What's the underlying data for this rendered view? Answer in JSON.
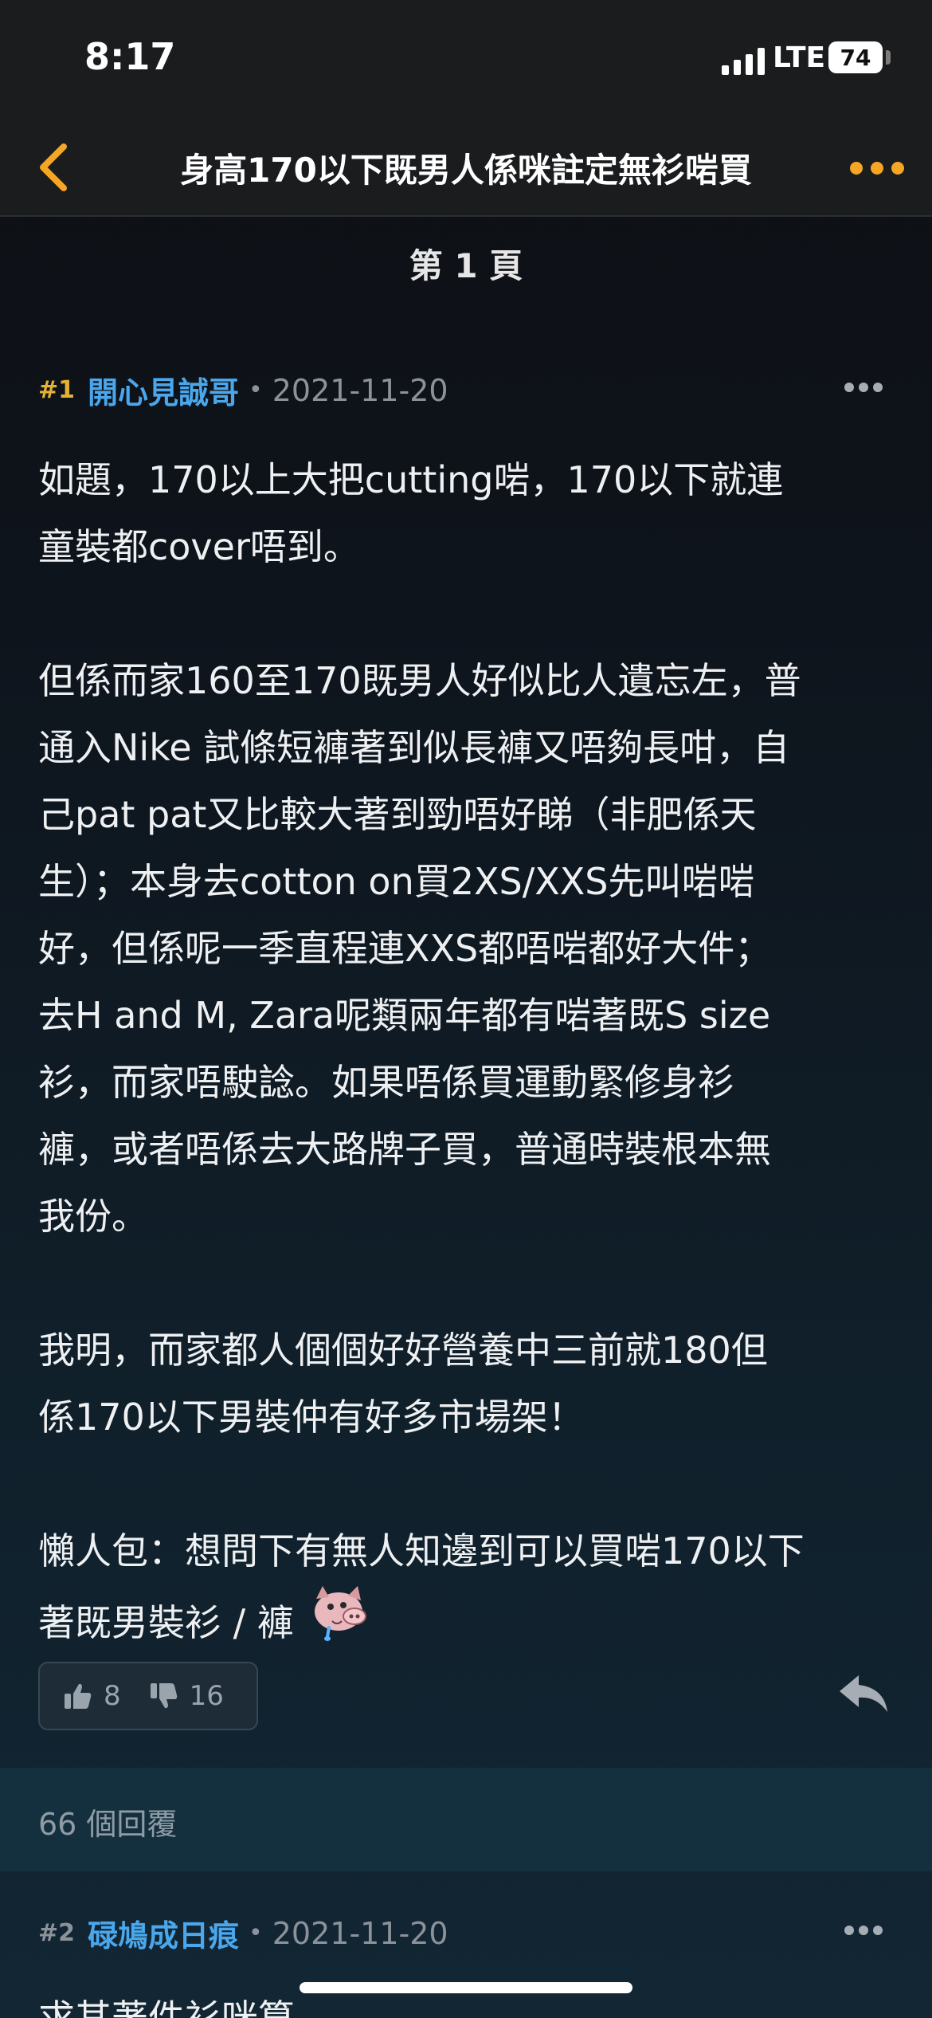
{
  "status_bar": {
    "time": "8:17",
    "network": "LTE",
    "battery": "74"
  },
  "nav": {
    "title": "身高170以下既男人係咪註定無衫啱買"
  },
  "page_label": "第 1 頁",
  "post1": {
    "number": "#1",
    "author": "開心見誠哥",
    "date": "2021-11-20",
    "body": "如題，170以上大把cutting啱，170以下就連\n童裝都cover唔到。\n\n但係而家160至170既男人好似比人遺忘左，普\n通入Nike 試條短褲著到似長褲又唔夠長咁，自\n己pat pat又比較大著到勁唔好睇（非肥係天\n生）；本身去cotton on買2XS/XXS先叫啱啱\n好，但係呢一季直程連XXS都唔啱都好大件；\n去H and M, Zara呢類兩年都有啱著既S size\n衫，而家唔駛諗。如果唔係買運動緊修身衫\n褲，或者唔係去大路牌子買，普通時裝根本無\n我份。\n\n我明，而家都人個個好好營養中三前就180但\n係170以下男裝仲有好多市場架！\n\n懶人包：想問下有無人知邊到可以買啱170以下\n著既男裝衫 / 褲",
    "upvotes": "8",
    "downvotes": "16"
  },
  "replies": {
    "count_label": "66 個回覆"
  },
  "post2": {
    "number": "#2",
    "author": "碌鳩成日痕",
    "date": "2021-11-20",
    "preview": "求其著件衫咪算"
  },
  "colors": {
    "accent": "#f5a623",
    "author": "#4aa7ec",
    "post_number": "#e2b234"
  },
  "icons": [
    "back-chevron-icon",
    "more-dots-icon",
    "thumbs-up-icon",
    "thumbs-down-icon",
    "reply-arrow-icon",
    "pig-sticker-icon"
  ]
}
